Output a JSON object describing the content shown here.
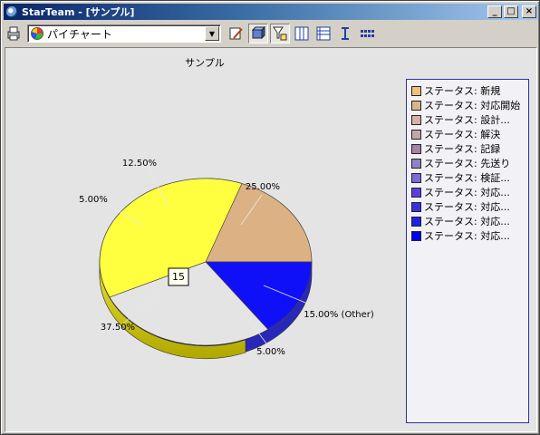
{
  "window": {
    "title": "StarTeam - [サンプル]",
    "buttons": {
      "minimize": "_",
      "maximize": "□",
      "close": "×"
    }
  },
  "toolbar": {
    "chart_type_value": "パイチャート",
    "icons": [
      "print-icon",
      "edit-chart-icon",
      "3d-icon",
      "filter-icon",
      "columns-icon",
      "rows-icon",
      "axis-icon",
      "grid-icon"
    ]
  },
  "chart_data": {
    "type": "pie",
    "title": "サンプル",
    "tooltip_value": "15",
    "slices": [
      {
        "label": "ステータス: 新規",
        "pct": 25.0,
        "text": "25.00%",
        "color": "#f0c080"
      },
      {
        "label": "ステータス: 対応開始",
        "pct": 12.5,
        "text": "12.50%",
        "color": "#d8b48c"
      },
      {
        "label": "ステータス: 設計...",
        "pct": 5.0,
        "text": "5.00%",
        "color": "#d8b0a8"
      },
      {
        "label": "ステータス: 解決",
        "pct": 37.5,
        "text": "37.50%",
        "color": "#c0a8a8"
      },
      {
        "label": "ステータス: 記録",
        "pct": 5.0,
        "text": "5.00%",
        "color": "#a880a8"
      },
      {
        "label": "ステータス: 先送り",
        "pct": 15.0,
        "text": "15.00% (Other)",
        "color": "#9080c8"
      }
    ],
    "legend": [
      {
        "label": "ステータス: 新規",
        "color": "#f0c080"
      },
      {
        "label": "ステータス: 対応開始",
        "color": "#d8b48c"
      },
      {
        "label": "ステータス: 設計...",
        "color": "#d8b0a8"
      },
      {
        "label": "ステータス: 解決",
        "color": "#c0a8a8"
      },
      {
        "label": "ステータス: 記録",
        "color": "#a880a8"
      },
      {
        "label": "ステータス: 先送り",
        "color": "#9080c8"
      },
      {
        "label": "ステータス: 検証...",
        "color": "#7c6ad8"
      },
      {
        "label": "ステータス: 対応...",
        "color": "#5a40e0"
      },
      {
        "label": "ステータス: 対応...",
        "color": "#3a30e0"
      },
      {
        "label": "ステータス: 対応...",
        "color": "#2020e8"
      },
      {
        "label": "ステータス: 対応...",
        "color": "#0000f8"
      }
    ],
    "legend_position": "right"
  }
}
